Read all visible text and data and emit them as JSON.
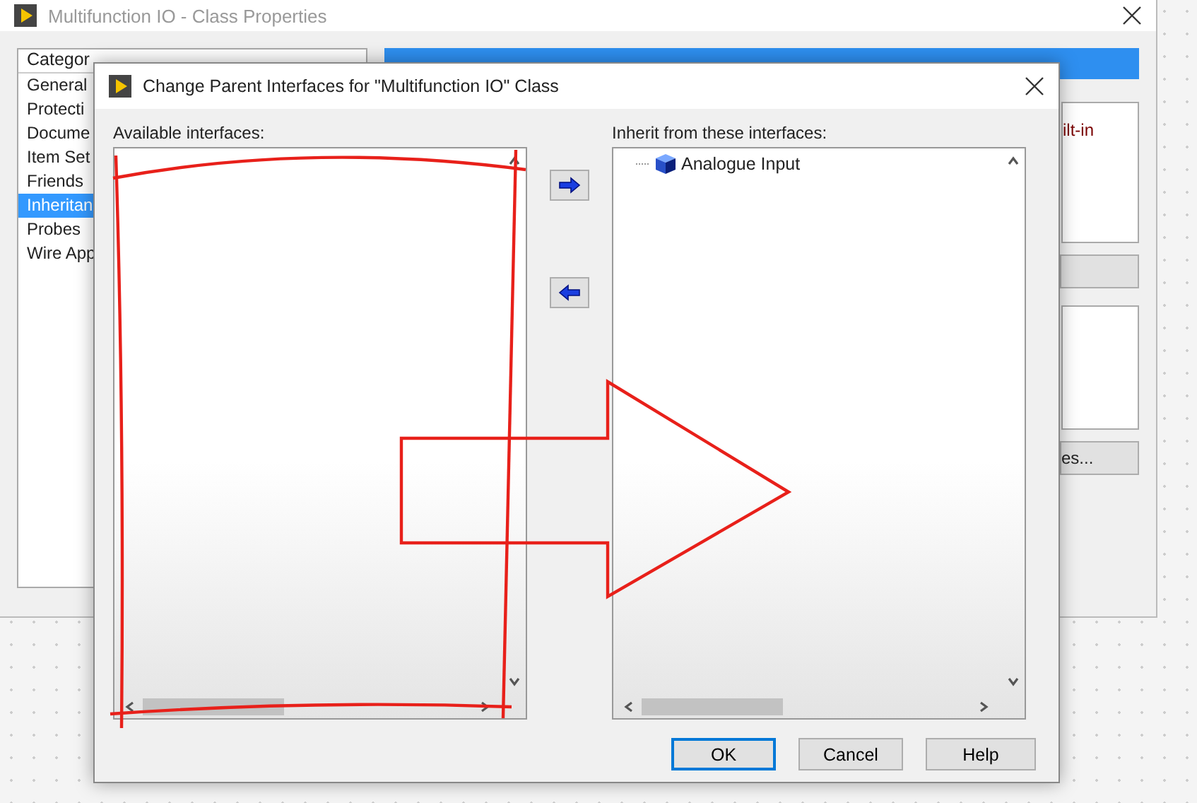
{
  "background_window": {
    "title": "Multifunction IO - Class Properties",
    "category_header": "Categor",
    "categories": [
      {
        "label": "General",
        "selected": false
      },
      {
        "label": "Protecti",
        "selected": false
      },
      {
        "label": "Docume",
        "selected": false
      },
      {
        "label": "Item Set",
        "selected": false
      },
      {
        "label": "Friends",
        "selected": false
      },
      {
        "label": "Inheritan",
        "selected": true
      },
      {
        "label": "Probes",
        "selected": false
      },
      {
        "label": "Wire App",
        "selected": false
      }
    ],
    "list_fragment": "ilt-in",
    "button_fragment": "es..."
  },
  "dialog": {
    "title": "Change Parent Interfaces for \"Multifunction IO\" Class",
    "available_label": "Available interfaces:",
    "inherit_label": "Inherit from these interfaces:",
    "inherited": [
      {
        "label": "Analogue Input"
      }
    ],
    "move_buttons": [
      {
        "kind": "add"
      },
      {
        "kind": "remove"
      }
    ],
    "buttons": [
      {
        "label": "OK",
        "default": true
      },
      {
        "label": "Cancel",
        "default": false
      },
      {
        "label": "Help",
        "default": false
      }
    ]
  }
}
